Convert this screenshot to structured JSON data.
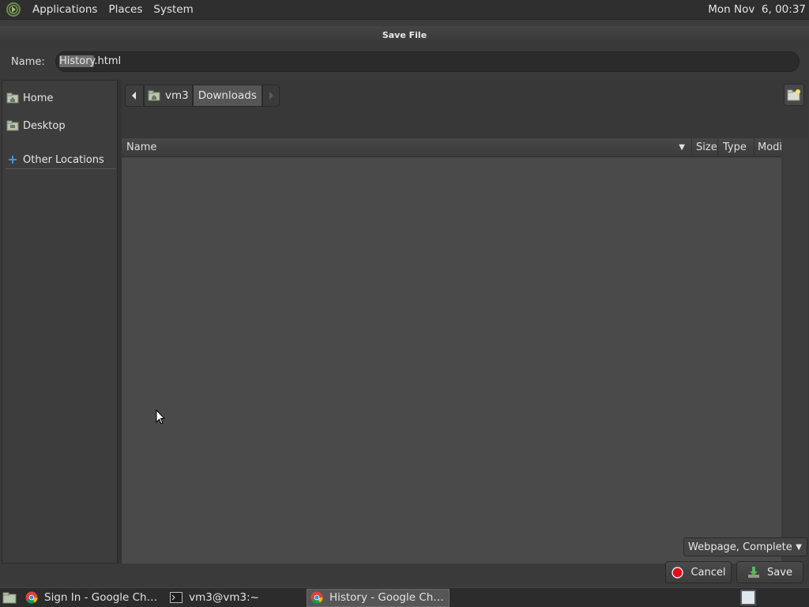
{
  "top_panel": {
    "menus": [
      "Applications",
      "Places",
      "System"
    ],
    "clock": "Mon Nov  6, 00:37"
  },
  "dialog": {
    "title": "Save File",
    "name_label": "Name:",
    "filename_selected": "History",
    "filename_rest": ".html",
    "sidebar": {
      "items": [
        {
          "label": "Home",
          "icon": "home-folder-icon"
        },
        {
          "label": "Desktop",
          "icon": "desktop-folder-icon"
        },
        {
          "label": "Other Locations",
          "icon": "plus-icon"
        }
      ]
    },
    "pathbar": {
      "segments": [
        "vm3",
        "Downloads"
      ],
      "active": "Downloads"
    },
    "columns": {
      "name": "Name",
      "size": "Size",
      "type": "Type",
      "modified": "Modif"
    },
    "file_type": "Webpage, Complete",
    "cancel_label": "Cancel",
    "save_label": "Save"
  },
  "taskbar": {
    "tasks": [
      {
        "label": "Sign In - Google Ch…",
        "icon": "chrome-icon",
        "active": false
      },
      {
        "label": "vm3@vm3:~",
        "icon": "terminal-icon",
        "active": false
      },
      {
        "label": "History - Google Ch…",
        "icon": "chrome-icon",
        "active": true
      }
    ]
  },
  "colors": {
    "panel_bg": "#2f2f2f",
    "dialog_bg": "#3a3a3a",
    "filelist_bg": "#4a4a4a",
    "cancel_icon": "#e0101a",
    "save_icon": "#5cb85c"
  }
}
